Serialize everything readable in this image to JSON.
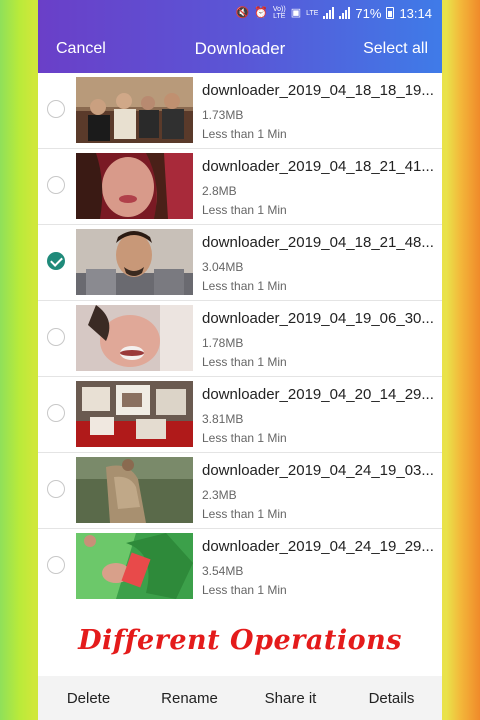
{
  "status": {
    "volte": "Vo))",
    "lte": "LTE",
    "lte2": "LTE",
    "battery": "71%",
    "time": "13:14"
  },
  "appbar": {
    "cancel": "Cancel",
    "title": "Downloader",
    "select_all": "Select all"
  },
  "items": [
    {
      "name": "downloader_2019_04_18_18_19...",
      "size": "1.73MB",
      "age": "Less than 1 Min",
      "checked": false
    },
    {
      "name": "downloader_2019_04_18_21_41...",
      "size": "2.8MB",
      "age": "Less than 1 Min",
      "checked": false
    },
    {
      "name": "downloader_2019_04_18_21_48...",
      "size": "3.04MB",
      "age": "Less than 1 Min",
      "checked": true
    },
    {
      "name": "downloader_2019_04_19_06_30...",
      "size": "1.78MB",
      "age": "Less than 1 Min",
      "checked": false
    },
    {
      "name": "downloader_2019_04_20_14_29...",
      "size": "3.81MB",
      "age": "Less than 1 Min",
      "checked": false
    },
    {
      "name": "downloader_2019_04_24_19_03...",
      "size": "2.3MB",
      "age": "Less than 1 Min",
      "checked": false
    },
    {
      "name": "downloader_2019_04_24_19_29...",
      "size": "3.54MB",
      "age": "Less than 1 Min",
      "checked": false
    }
  ],
  "banner": "Different Operations",
  "actions": {
    "delete": "Delete",
    "rename": "Rename",
    "share": "Share it",
    "details": "Details"
  }
}
